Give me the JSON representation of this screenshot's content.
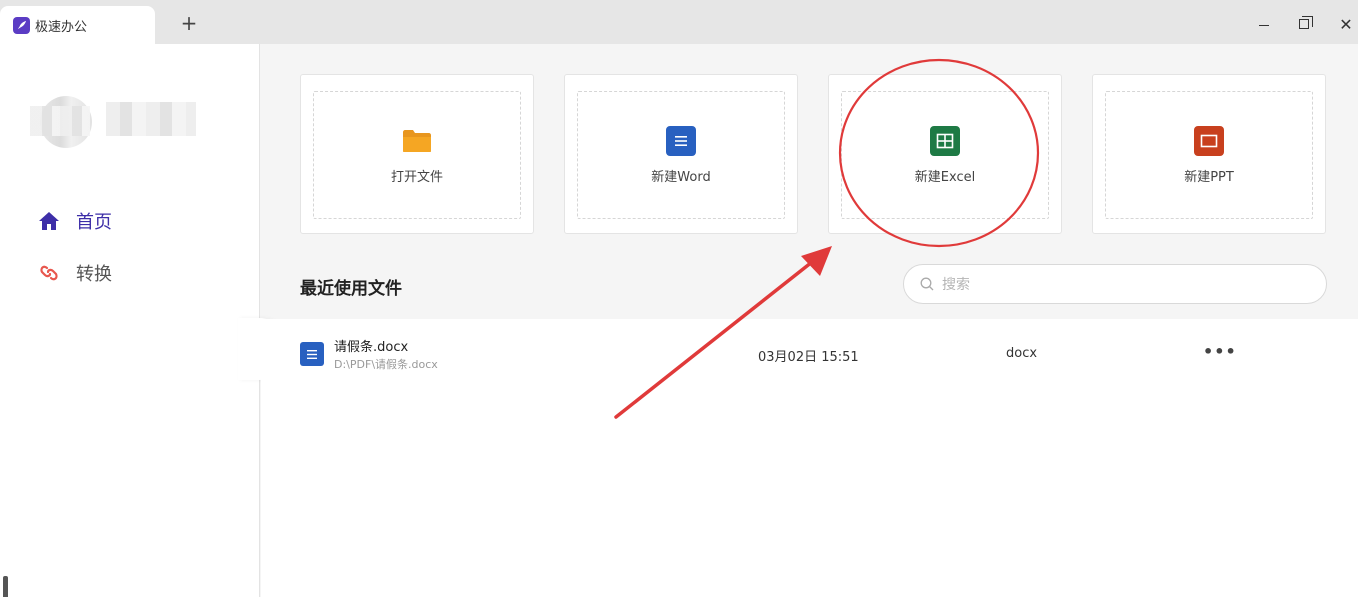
{
  "window": {
    "tab_title": "极速办公",
    "new_tab": "+",
    "minimize": "",
    "maximize": "",
    "close": "✕"
  },
  "sidebar": {
    "items": [
      {
        "label": "首页",
        "icon": "home-icon",
        "active": true
      },
      {
        "label": "转换",
        "icon": "link-icon",
        "active": false
      }
    ],
    "collapse_icon": "chevron-left-icon"
  },
  "actions": [
    {
      "label": "打开文件",
      "icon": "folder-icon",
      "color": "#f5a623"
    },
    {
      "label": "新建Word",
      "icon": "word-icon",
      "color": "#2860c0"
    },
    {
      "label": "新建Excel",
      "icon": "excel-icon",
      "color": "#1e7a45"
    },
    {
      "label": "新建PPT",
      "icon": "ppt-icon",
      "color": "#c8401e"
    }
  ],
  "recent": {
    "title": "最近使用文件",
    "search_placeholder": "搜索",
    "files": [
      {
        "name": "请假条.docx",
        "path": "D:\\PDF\\请假条.docx",
        "date": "03月02日 15:51",
        "type": "docx",
        "more": "•••"
      }
    ]
  },
  "colors": {
    "accent": "#3d2ea8",
    "annotation_red": "#e03a3a"
  }
}
